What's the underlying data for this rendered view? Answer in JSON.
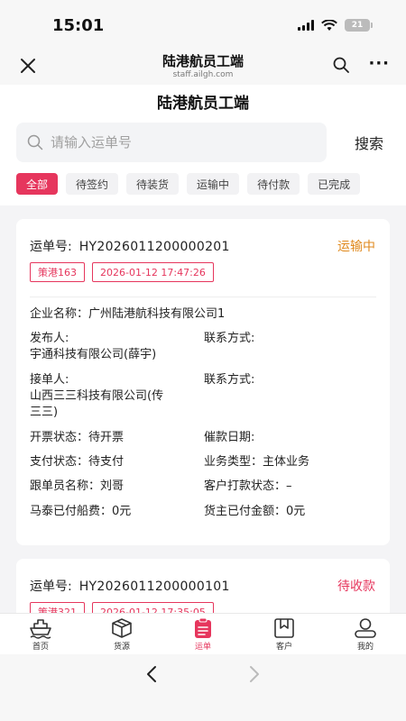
{
  "status_bar": {
    "time": "15:01",
    "battery": "21"
  },
  "browser": {
    "title": "陆港航员工端",
    "url": "staff.ailgh.com"
  },
  "page": {
    "title": "陆港航员工端"
  },
  "search": {
    "placeholder": "请输入运单号",
    "button_label": "搜索"
  },
  "tabs": [
    {
      "label": "全部",
      "active": true
    },
    {
      "label": "待签约",
      "active": false
    },
    {
      "label": "待装货",
      "active": false
    },
    {
      "label": "运输中",
      "active": false
    },
    {
      "label": "待付款",
      "active": false
    },
    {
      "label": "已完成",
      "active": false
    }
  ],
  "orders": [
    {
      "waybill_label": "运单号:",
      "waybill_no": "HY2026011200000201",
      "status": "运输中",
      "status_color": "#e08a1e",
      "tags": [
        "策港163",
        "2026-01-12 17:47:26"
      ],
      "company": "企业名称：广州陆港航科技有限公司1",
      "publisher_label": "发布人:",
      "publisher_value": "宇通科技有限公司(薛宇)",
      "publisher_contact": "联系方式:",
      "receiver_label": "接单人:",
      "receiver_value_line1": "山西三三科技有限公司(传",
      "receiver_value_line2": "三三)",
      "receiver_contact": "联系方式:",
      "invoice_status": "开票状态：待开票",
      "dunning_date": "催款日期:",
      "pay_status": "支付状态：待支付",
      "business_type": "业务类型：主体业务",
      "follower": "跟单员名称：刘哥",
      "customer_pay_status": "客户打款状态：–",
      "matai_paid": "马泰已付船费：0元",
      "cargo_owner_paid": "货主已付金额：0元"
    },
    {
      "waybill_label": "运单号:",
      "waybill_no": "HY2026011200000101",
      "status": "待收款",
      "status_color": "#e6365d",
      "tags": [
        "策港321",
        "2026-01-12 17:35:05"
      ]
    }
  ],
  "tabbar": [
    {
      "label": "首页",
      "icon": "ship-icon",
      "active": false
    },
    {
      "label": "货源",
      "icon": "box-icon",
      "active": false
    },
    {
      "label": "运单",
      "icon": "clipboard-icon",
      "active": true
    },
    {
      "label": "客户",
      "icon": "bookmark-icon",
      "active": false
    },
    {
      "label": "我的",
      "icon": "user-icon",
      "active": false
    }
  ],
  "colors": {
    "accent": "#e6365d",
    "in_transit": "#e08a1e"
  }
}
